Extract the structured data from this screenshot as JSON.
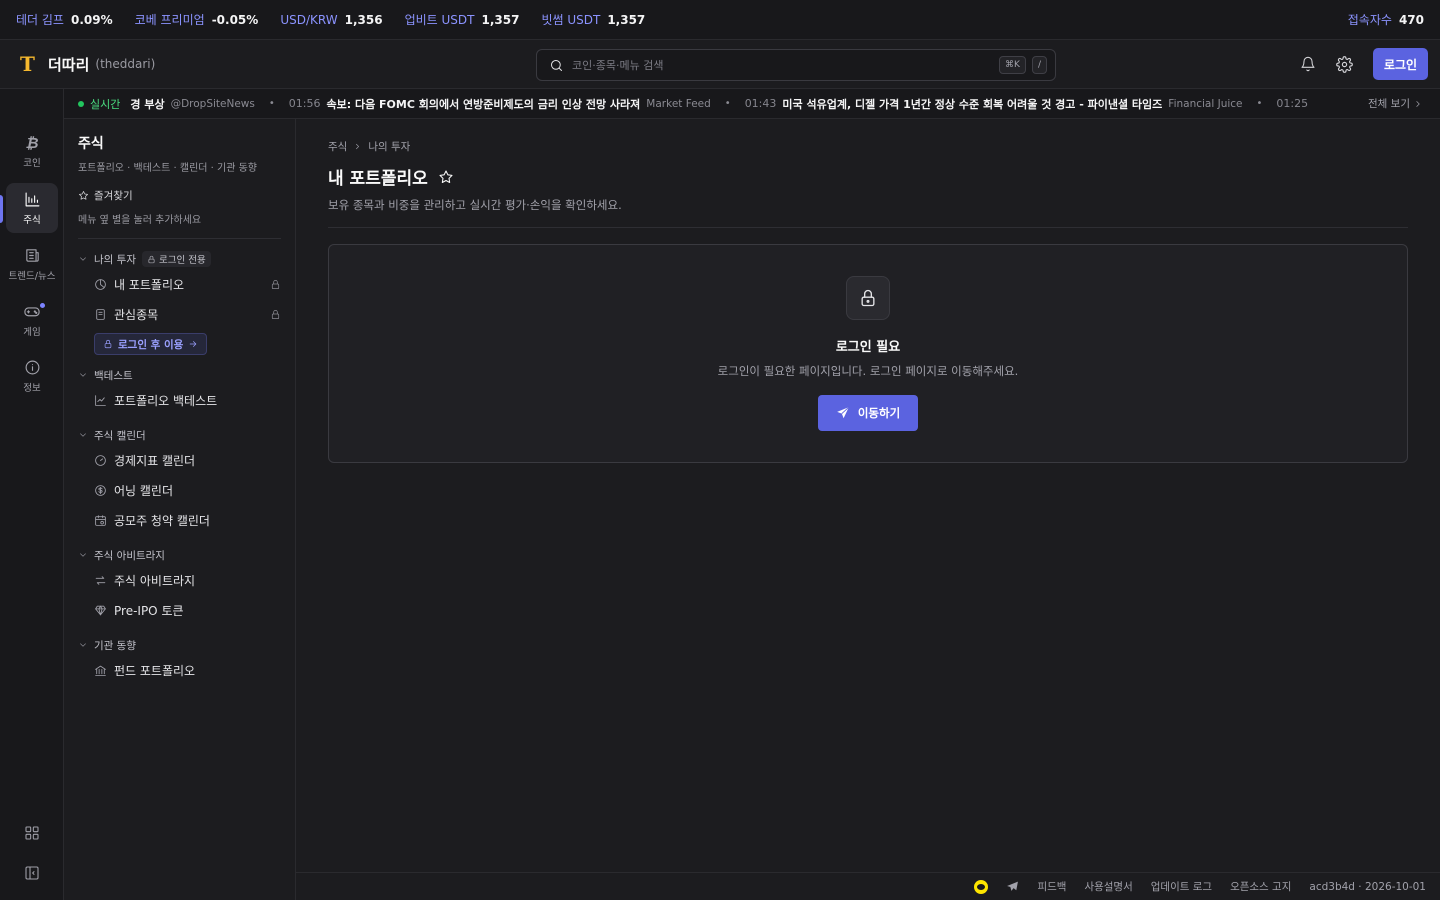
{
  "ticker": {
    "items": [
      {
        "label": "테더 김프",
        "value": "0.09%"
      },
      {
        "label": "코베 프리미엄",
        "value": "-0.05%"
      },
      {
        "label": "USD/KRW",
        "value": "1,356"
      },
      {
        "label": "업비트 USDT",
        "value": "1,357"
      },
      {
        "label": "빗썸 USDT",
        "value": "1,357"
      }
    ],
    "visitors_label": "접속자수",
    "visitors_value": "470"
  },
  "header": {
    "logo_letter": "T",
    "brand": "더따리",
    "brand_sub": "(theddari)",
    "search_placeholder": "코인·종목·메뉴 검색",
    "kbd1": "⌘K",
    "kbd2": "/",
    "login": "로그인"
  },
  "news": {
    "live_label": "실시간",
    "items": [
      {
        "time": "",
        "headline": "경 부상",
        "source": "@DropSiteNews"
      },
      {
        "time": "01:56",
        "headline": "속보: 다음 FOMC 회의에서 연방준비제도의 금리 인상 전망 사라져",
        "source": "Market Feed"
      },
      {
        "time": "01:43",
        "headline": "미국 석유업계, 디젤 가격 1년간 정상 수준 회복 어려울 것 경고 - 파이낸셜 타임즈",
        "source": "Financial Juice"
      },
      {
        "time": "01:25",
        "headline": "",
        "source": ""
      }
    ],
    "see_all": "전체 보기"
  },
  "rail": {
    "items": [
      {
        "label": "코인",
        "icon": "bitcoin-icon"
      },
      {
        "label": "주식",
        "icon": "chart-icon"
      },
      {
        "label": "트렌드/뉴스",
        "icon": "newspaper-icon"
      },
      {
        "label": "게임",
        "icon": "gamepad-icon"
      },
      {
        "label": "정보",
        "icon": "info-icon"
      }
    ],
    "active": "주식"
  },
  "sub": {
    "title": "주식",
    "desc": "포트폴리오 · 백테스트 · 캘린더 · 기관 동향",
    "fav_label": "즐겨찾기",
    "fav_hint": "메뉴 옆 별을 눌러 추가하세요",
    "my_invest": {
      "label": "나의 투자",
      "tag": "로그인 전용",
      "items": [
        "내 포트폴리오",
        "관심종목"
      ],
      "login_use": "로그인 후 이용"
    },
    "backtest": {
      "label": "백테스트",
      "items": [
        "포트폴리오 백테스트"
      ]
    },
    "calendar": {
      "label": "주식 캘린더",
      "items": [
        "경제지표 캘린더",
        "어닝 캘린더",
        "공모주 청약 캘린더"
      ]
    },
    "arbitrage": {
      "label": "주식 아비트라지",
      "items": [
        "주식 아비트라지",
        "Pre-IPO 토큰"
      ]
    },
    "institution": {
      "label": "기관 동향",
      "items": [
        "펀드 포트폴리오"
      ]
    }
  },
  "main": {
    "breadcrumb": [
      "주식",
      "나의 투자"
    ],
    "title": "내 포트폴리오",
    "desc": "보유 종목과 비중을 관리하고 실시간 평가·손익을 확인하세요.",
    "card_title": "로그인 필요",
    "card_desc": "로그인이 필요한 페이지입니다. 로그인 페이지로 이동해주세요.",
    "go_button": "이동하기"
  },
  "footer": {
    "links": [
      "피드백",
      "사용설명서",
      "업데이트 로그",
      "오픈소스 고지"
    ],
    "version": "acd3b4d · 2026-10-01"
  },
  "colors": {
    "accent": "#5b63e0",
    "brand": "#f5b82e",
    "live": "#22c55e",
    "background": "#1c1c1f"
  }
}
